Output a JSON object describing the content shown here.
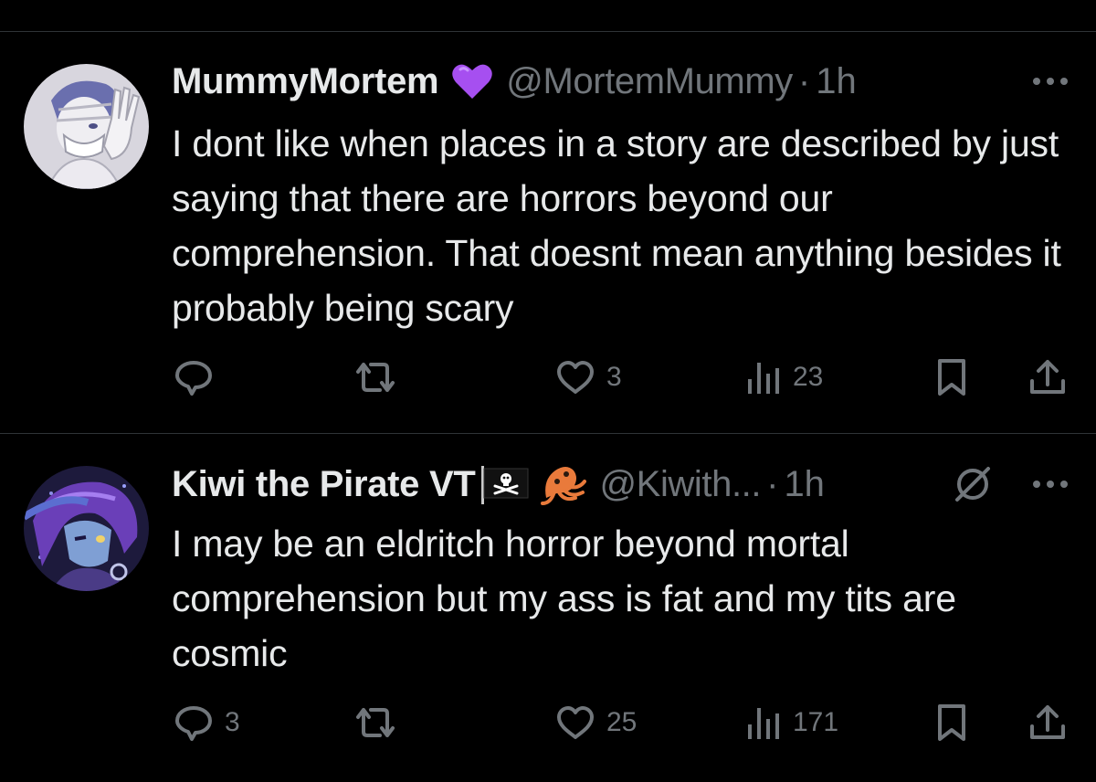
{
  "colors": {
    "background": "#000000",
    "text_primary": "#e7e9ea",
    "text_secondary": "#71767b",
    "divider": "#2f3336"
  },
  "tweets": [
    {
      "display_name": "MummyMortem",
      "badge_emoji": "purple-heart",
      "handle": "@MortemMummy",
      "dot": "·",
      "time": "1h",
      "text": "I dont like when places in a story are described by just saying that there are horrors beyond our comprehension. That doesnt mean anything besides it probably being scary",
      "actions": {
        "reply_count": "",
        "retweet_count": "",
        "like_count": "3",
        "view_count": "23"
      }
    },
    {
      "display_name": "Kiwi the Pirate VT",
      "badge_emoji": "pirate-flag, squid",
      "handle": "@Kiwith...",
      "dot": "·",
      "time": "1h",
      "text": "I may be an eldritch horror beyond mortal comprehension but my ass is fat and my tits are cosmic",
      "actions": {
        "reply_count": "3",
        "retweet_count": "",
        "like_count": "25",
        "view_count": "171"
      }
    }
  ]
}
